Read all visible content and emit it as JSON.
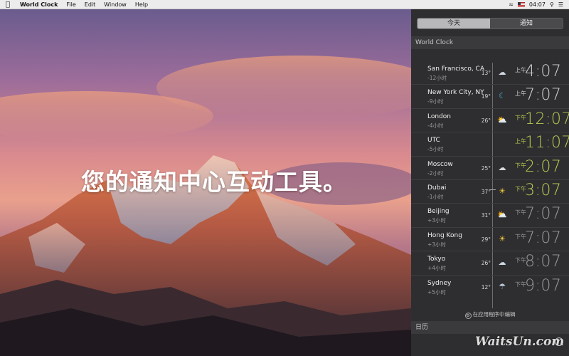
{
  "menubar": {
    "app_name": "World Clock",
    "menus": [
      "File",
      "Edit",
      "Window",
      "Help"
    ],
    "clock": "04:07"
  },
  "desktop": {
    "headline": "您的通知中心互动工具。"
  },
  "notification_center": {
    "tabs": [
      {
        "label": "今天",
        "active": true
      },
      {
        "label": "通知",
        "active": false
      }
    ],
    "widget_title": "World Clock",
    "cities": [
      {
        "name": "San Francisco, CA",
        "offset": "-12小时",
        "temp": "13°",
        "icon": "partly-cloudy-night-icon",
        "ampm": "上午",
        "time": "4:07",
        "phase": "night"
      },
      {
        "name": "New York City, NY",
        "offset": "-9小时",
        "temp": "19°",
        "icon": "moon-icon",
        "ampm": "上午",
        "time": "7:07",
        "phase": "night"
      },
      {
        "name": "London",
        "offset": "-4小时",
        "temp": "26°",
        "icon": "partly-cloudy-day-icon",
        "ampm": "下午",
        "time": "12:07",
        "phase": "day"
      },
      {
        "name": "UTC",
        "offset": "-5小时",
        "temp": "",
        "icon": "",
        "ampm": "上午",
        "time": "11:07",
        "phase": "day"
      },
      {
        "name": "Moscow",
        "offset": "-2小时",
        "temp": "25°",
        "icon": "cloud-icon",
        "ampm": "下午",
        "time": "2:07",
        "phase": "day"
      },
      {
        "name": "Dubai",
        "offset": "-1小时",
        "temp": "37°",
        "icon": "sun-icon",
        "ampm": "下午",
        "time": "3:07",
        "phase": "day"
      },
      {
        "name": "Beijing",
        "offset": "+3小时",
        "temp": "31°",
        "icon": "partly-cloudy-day-icon",
        "ampm": "下午",
        "time": "7:07",
        "phase": "dim"
      },
      {
        "name": "Hong Kong",
        "offset": "+3小时",
        "temp": "29°",
        "icon": "sun-icon",
        "ampm": "下午",
        "time": "7:07",
        "phase": "dim"
      },
      {
        "name": "Tokyo",
        "offset": "+4小时",
        "temp": "26°",
        "icon": "partly-cloudy-night-icon",
        "ampm": "下午",
        "time": "8:07",
        "phase": "dim"
      },
      {
        "name": "Sydney",
        "offset": "+5小时",
        "temp": "12°",
        "icon": "rain-cloud-icon",
        "ampm": "下午",
        "time": "9:07",
        "phase": "dim"
      }
    ],
    "edit_label": "在应用程序中编辑",
    "calendar_title": "日历"
  },
  "watermark": "WaitsUn.com",
  "colors": {
    "day_accent": "#b6cc52",
    "panel_bg": "#2e2e30"
  }
}
